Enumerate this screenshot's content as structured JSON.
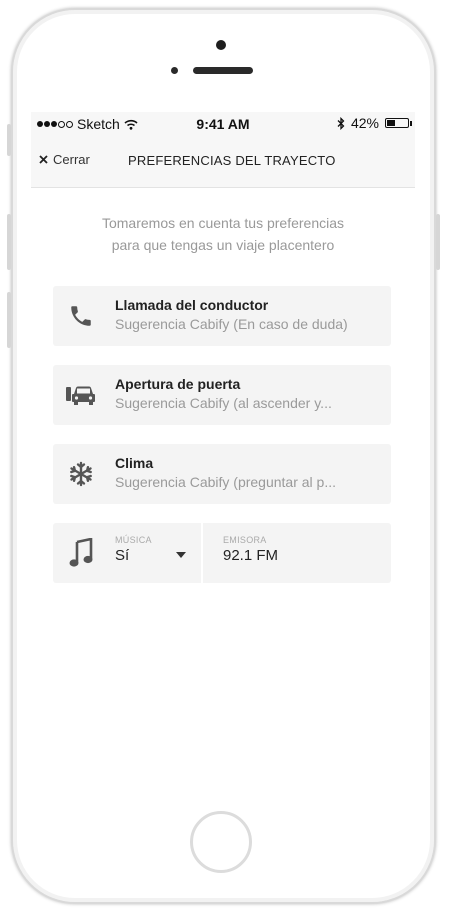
{
  "status_bar": {
    "carrier": "Sketch",
    "time": "9:41 AM",
    "battery": "42%",
    "battery_level": 0.42
  },
  "nav": {
    "close_label": "Cerrar",
    "title": "PREFERENCIAS DEL TRAYECTO"
  },
  "intro": {
    "line1": "Tomaremos en cuenta tus preferencias",
    "line2": "para que tengas un viaje placentero"
  },
  "preferences": [
    {
      "icon": "phone-icon",
      "title": "Llamada del conductor",
      "subtitle": "Sugerencia Cabify (En caso de duda)"
    },
    {
      "icon": "car-door-icon",
      "title": "Apertura de puerta",
      "subtitle": "Sugerencia Cabify (al ascender y..."
    },
    {
      "icon": "snowflake-icon",
      "title": "Clima",
      "subtitle": "Sugerencia Cabify (preguntar al p..."
    }
  ],
  "music": {
    "icon": "music-note-icon",
    "label": "MÚSICA",
    "value": "Sí",
    "station_label": "EMISORA",
    "station_value": "92.1 FM"
  },
  "colors": {
    "card_bg": "#f4f4f4",
    "muted_text": "#9a9a9a",
    "bar_bg": "#f7f7f7"
  }
}
